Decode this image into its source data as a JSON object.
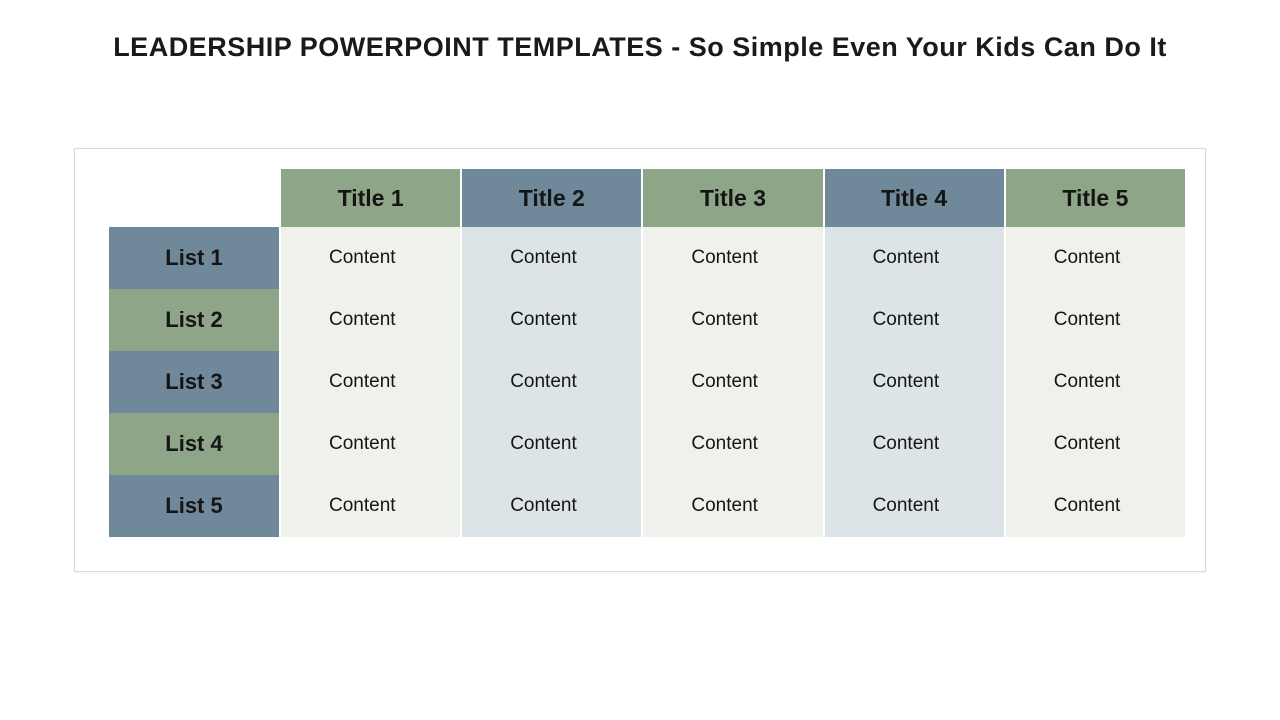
{
  "title": "LEADERSHIP POWERPOINT TEMPLATES - So Simple Even Your Kids Can Do It",
  "columns": [
    {
      "label": "Title 1",
      "headerColor": "green",
      "bodyColor": "green"
    },
    {
      "label": "Title 2",
      "headerColor": "blue",
      "bodyColor": "blue"
    },
    {
      "label": "Title 3",
      "headerColor": "green",
      "bodyColor": "green"
    },
    {
      "label": "Title 4",
      "headerColor": "blue",
      "bodyColor": "blue"
    },
    {
      "label": "Title 5",
      "headerColor": "green",
      "bodyColor": "green"
    }
  ],
  "rows": [
    {
      "label": "List 1",
      "headerColor": "blue",
      "cells": [
        "Content",
        "Content",
        "Content",
        "Content",
        "Content"
      ]
    },
    {
      "label": "List 2",
      "headerColor": "green",
      "cells": [
        "Content",
        "Content",
        "Content",
        "Content",
        "Content"
      ]
    },
    {
      "label": "List 3",
      "headerColor": "blue",
      "cells": [
        "Content",
        "Content",
        "Content",
        "Content",
        "Content"
      ]
    },
    {
      "label": "List 4",
      "headerColor": "green",
      "cells": [
        "Content",
        "Content",
        "Content",
        "Content",
        "Content"
      ]
    },
    {
      "label": "List 5",
      "headerColor": "blue",
      "cells": [
        "Content",
        "Content",
        "Content",
        "Content",
        "Content"
      ]
    }
  ],
  "chart_data": {
    "type": "table",
    "title": "LEADERSHIP POWERPOINT TEMPLATES - So Simple Even Your Kids Can Do It",
    "columns": [
      "Title 1",
      "Title 2",
      "Title 3",
      "Title 4",
      "Title 5"
    ],
    "rows": [
      "List 1",
      "List 2",
      "List 3",
      "List 4",
      "List 5"
    ],
    "cells": [
      [
        "Content",
        "Content",
        "Content",
        "Content",
        "Content"
      ],
      [
        "Content",
        "Content",
        "Content",
        "Content",
        "Content"
      ],
      [
        "Content",
        "Content",
        "Content",
        "Content",
        "Content"
      ],
      [
        "Content",
        "Content",
        "Content",
        "Content",
        "Content"
      ],
      [
        "Content",
        "Content",
        "Content",
        "Content",
        "Content"
      ]
    ]
  }
}
